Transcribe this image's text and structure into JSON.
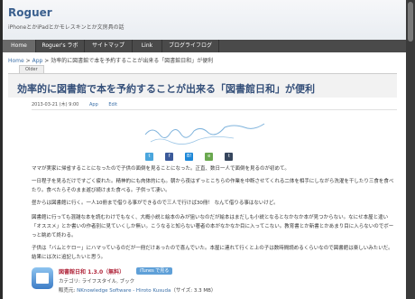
{
  "site": {
    "title": "Roguer",
    "tagline": "iPhoneとかiPadとかモレスキンとか文房具の話"
  },
  "nav": [
    {
      "label": "Home"
    },
    {
      "label": "Roguer's ラボ"
    },
    {
      "label": "サイトマップ"
    },
    {
      "label": "Link"
    },
    {
      "label": "ブログライフログ"
    }
  ],
  "breadcrumb": {
    "home": "Home",
    "app": "App",
    "current": "効率的に図書館で本を予約することが出来る「図書館日和」が便利",
    "separator": ">"
  },
  "post": {
    "category_tag": "Older",
    "title": "効率的に図書館で本を予約することが出来る「図書館日和」が便利",
    "date": "2013-03-21 (木) 9:00",
    "category": "App",
    "edit": "Edit",
    "signature_text": "Wataru hiyakura"
  },
  "share_icons": [
    {
      "icon": "twitter-icon",
      "glyph": "t",
      "color": "#4aa6dd"
    },
    {
      "icon": "facebook-icon",
      "glyph": "f",
      "color": "#3b5a9a"
    },
    {
      "icon": "hatena-icon",
      "glyph": "B!",
      "color": "#1e88d8"
    },
    {
      "icon": "evernote-icon",
      "glyph": "e",
      "color": "#6aa84f"
    },
    {
      "icon": "tumblr-icon",
      "glyph": "t",
      "color": "#36465d"
    }
  ],
  "paragraphs": [
    "ママが実家に帰省することになったので子供の面倒を見ることになった。正直、数日一人で面倒を見るのが初めて。",
    "一日程子を見るだけですごく疲れた。精神的にも肉体的にも。朝から夜はずっとこちらの作業を中断させてくれる二体を相手にしながら洗濯を干したり三食を食べたり。食べたらそのまま遊び続けまた食べる。子供って凄い。",
    "昼からは図書館に行く。一人10冊まで借りる事ができるので三人で行けば30冊！ なんて借りる事はないけど。",
    "図書館に行っても混雑な本を読むわけでもなく、大概小説と絵本のみが狙いなのだが絵本はまだしも小説となるとなかなか本が見つからない。なにせ本屋と違い「オススメ」とか書いの作者別に見ていくしか無い。こうなると知らない著者の本がなかなか目に入ってこない。教育書とか新書とかあまり目に入らないのでボーっと眺めて終わる。",
    "子供は「バムとケロー」にハマっているのだが一冊だけあったので喜んでいた。本屋に連れて行くと上の子は数時間読めるくらいなので図書館は楽しいみたいだ。結果には次に追記したいと思う。"
  ],
  "app": {
    "name": "図書館日和 1.3.0（無料）",
    "itunes_label": "iTunes で見る",
    "category_line": "カテゴリ: ライフスタイル, ブック",
    "seller_prefix": "販売元: ",
    "seller_link": "NKnowledge Software - Hiroto Kusuda",
    "size_text": "（サイズ: 3.3 MB）"
  }
}
